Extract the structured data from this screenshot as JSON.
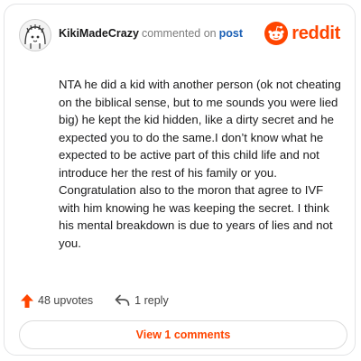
{
  "comment": {
    "username": "KikiMadeCrazy",
    "action_text": "commented on",
    "post_link": "post",
    "body": "NTA he did a kid with another person (ok not cheating on the biblical sense, but to me sounds you were lied big) he kept the kid hidden, like a dirty secret and he expected you to do the same.I don’t know what he expected to be active part of this child life and not introduce her the rest of his family or you. Congratulation also to the moron that agree to IVF with him knowing he was keeping the secret. I think his mental breakdown is due to years of lies and not you."
  },
  "brand": {
    "name": "reddit",
    "icon": "reddit-logo-icon",
    "color": "#ff4500"
  },
  "actions": {
    "upvotes_label": "48 upvotes",
    "upvote_icon": "upvote-arrow-icon",
    "upvote_color": "#ff4500",
    "replies_label": "1 reply",
    "reply_icon": "reply-arrow-icon"
  },
  "footer": {
    "view_comments_label": "View 1 comments"
  },
  "avatar": {
    "icon": "avatar-icon"
  }
}
